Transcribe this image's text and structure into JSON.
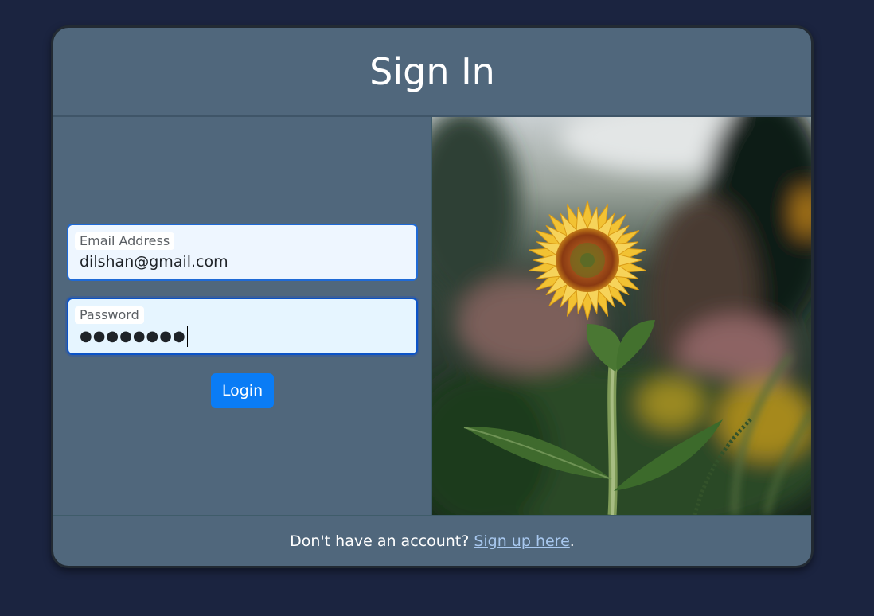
{
  "header": {
    "title": "Sign In"
  },
  "form": {
    "email": {
      "label": "Email Address",
      "value": "dilshan@gmail.com"
    },
    "password": {
      "label": "Password",
      "masked_value": "●●●●●●●●"
    },
    "login_label": "Login"
  },
  "photo": {
    "subject": "sunflower"
  },
  "footer": {
    "prompt": "Don't have an account?",
    "link_label": "Sign up here",
    "suffix": "."
  },
  "colors": {
    "page_background": "#1b2440",
    "card_background": "#50677c",
    "button": "#0a7cf5",
    "link": "#a8c8ef"
  }
}
